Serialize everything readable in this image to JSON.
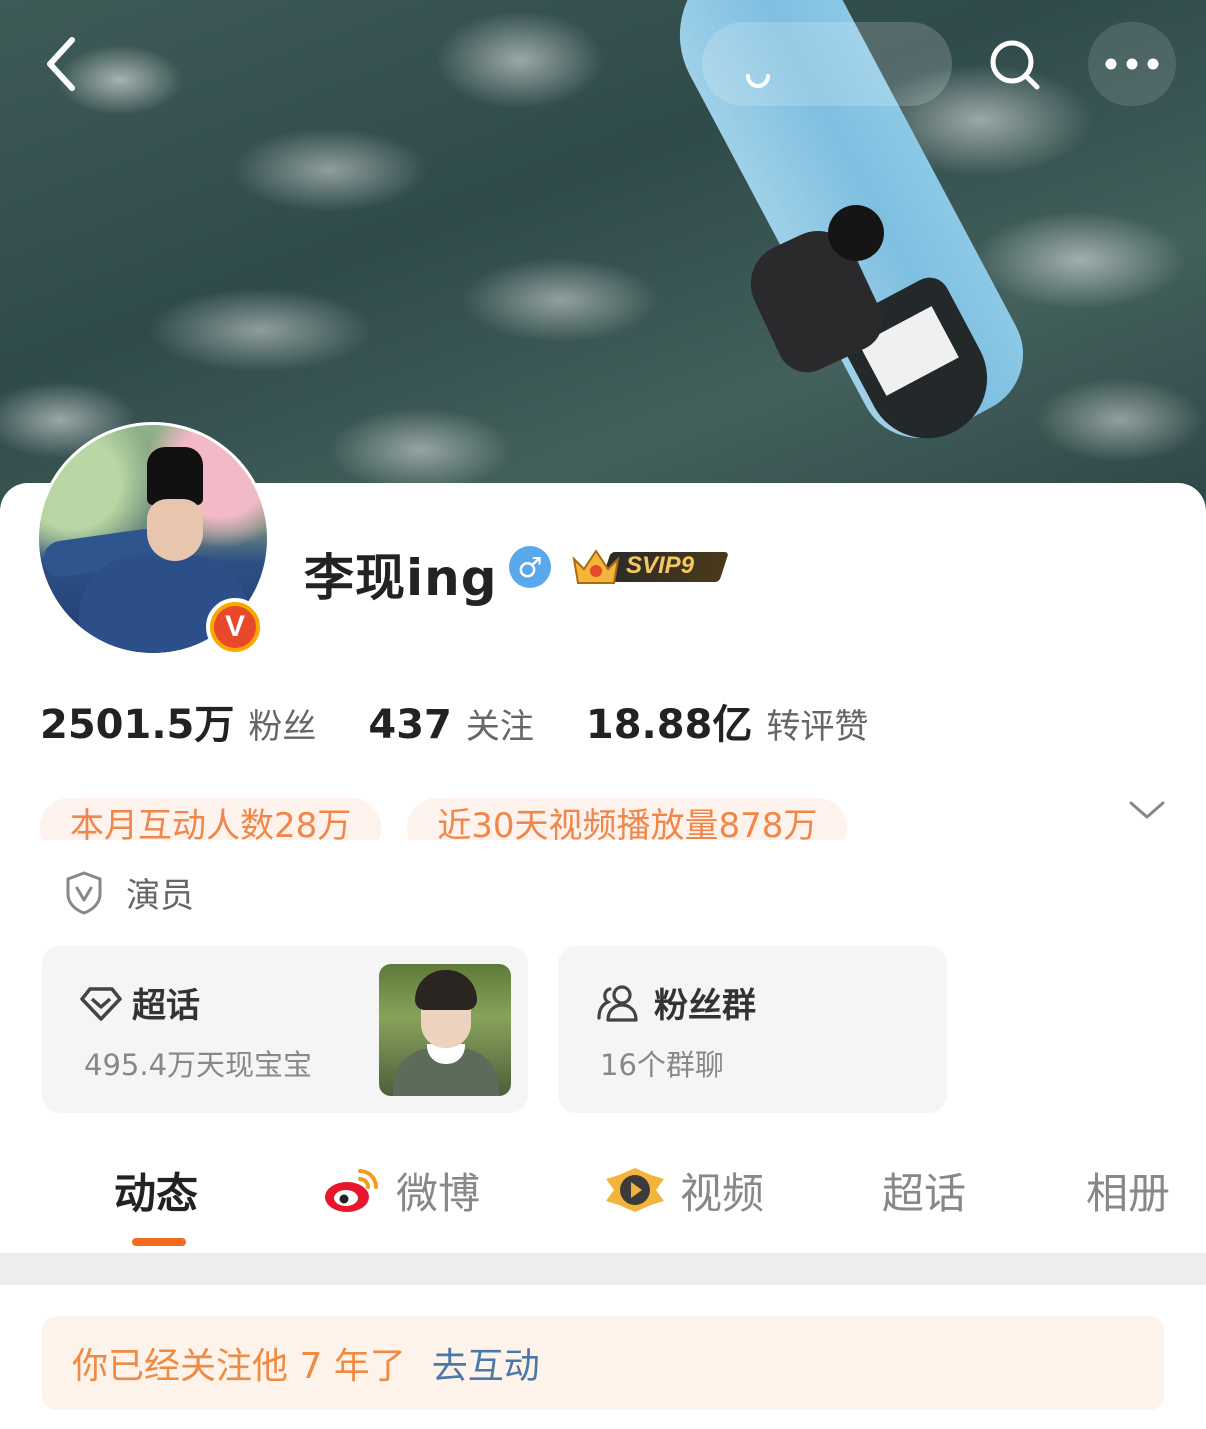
{
  "profile": {
    "name": "李现ing",
    "gender_symbol": "♂",
    "svip_label": "SVIP9",
    "verified_badge": "V"
  },
  "stats": [
    {
      "value": "2501.5万",
      "label": "粉丝"
    },
    {
      "value": "437",
      "label": "关注"
    },
    {
      "value": "18.88亿",
      "label": "转评赞"
    }
  ],
  "tags": [
    "本月互动人数28万",
    "近30天视频播放量878万"
  ],
  "identity": "演员",
  "cards": {
    "chaohua": {
      "title": "超话",
      "subtitle": "495.4万天现宝宝"
    },
    "fans_group": {
      "title": "粉丝群",
      "subtitle": "16个群聊"
    }
  },
  "tabs": [
    {
      "label": "动态",
      "active": true
    },
    {
      "label": "微博",
      "icon": "weibo-icon"
    },
    {
      "label": "视频",
      "icon": "video-icon"
    },
    {
      "label": "超话"
    },
    {
      "label": "相册"
    }
  ],
  "follow_notice": {
    "text": "你已经关注他 7 年了",
    "action": "去互动"
  },
  "colors": {
    "accent": "#f26b21",
    "tag_text": "#f0874a",
    "link": "#4b78a8",
    "verified": "#f8a800"
  }
}
